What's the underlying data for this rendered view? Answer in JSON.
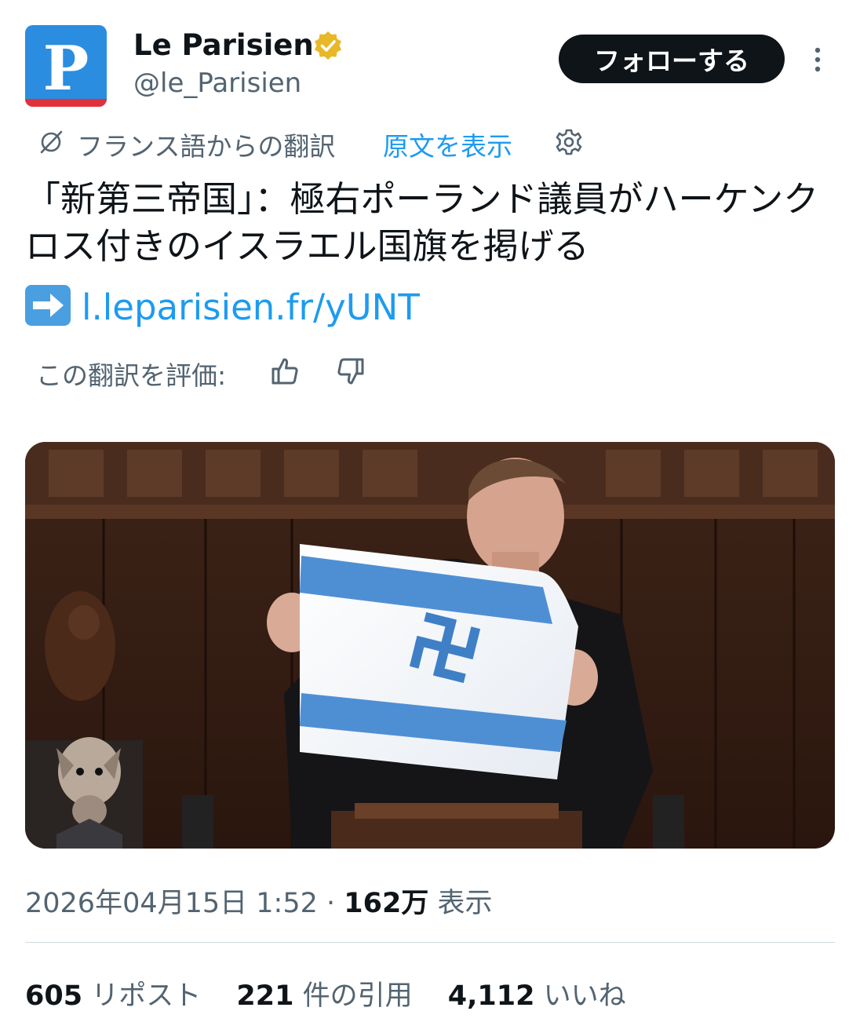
{
  "author": {
    "avatar_letter": "P",
    "display_name": "Le Parisien",
    "handle": "@le_Parisien",
    "verified_color": "#e8b829"
  },
  "follow_label": "フォローする",
  "translation": {
    "note": "フランス語からの翻訳",
    "show_original": "原文を表示"
  },
  "tweet": {
    "text": "「新第三帝国」：極右ポーランド議員がハーケンクロス付きのイスラエル国旗を掲げる",
    "link": "l.leparisien.fr/yUNT"
  },
  "rate_label": "この翻訳を評価:",
  "meta": {
    "datetime": "2026年04月15日 1:52",
    "separator": "·",
    "views_count": "162万",
    "views_label": "表示"
  },
  "stats": {
    "reposts_count": "605",
    "reposts_label": "リポスト",
    "quotes_count": "221",
    "quotes_label": "件の引用",
    "likes_count": "4,112",
    "likes_label": "いいね"
  },
  "colors": {
    "link": "#1d9bf0",
    "muted": "#536471",
    "avatar_blue": "#2a8de0",
    "avatar_red": "#e2313b",
    "flag_blue": "#4e8fd4"
  }
}
